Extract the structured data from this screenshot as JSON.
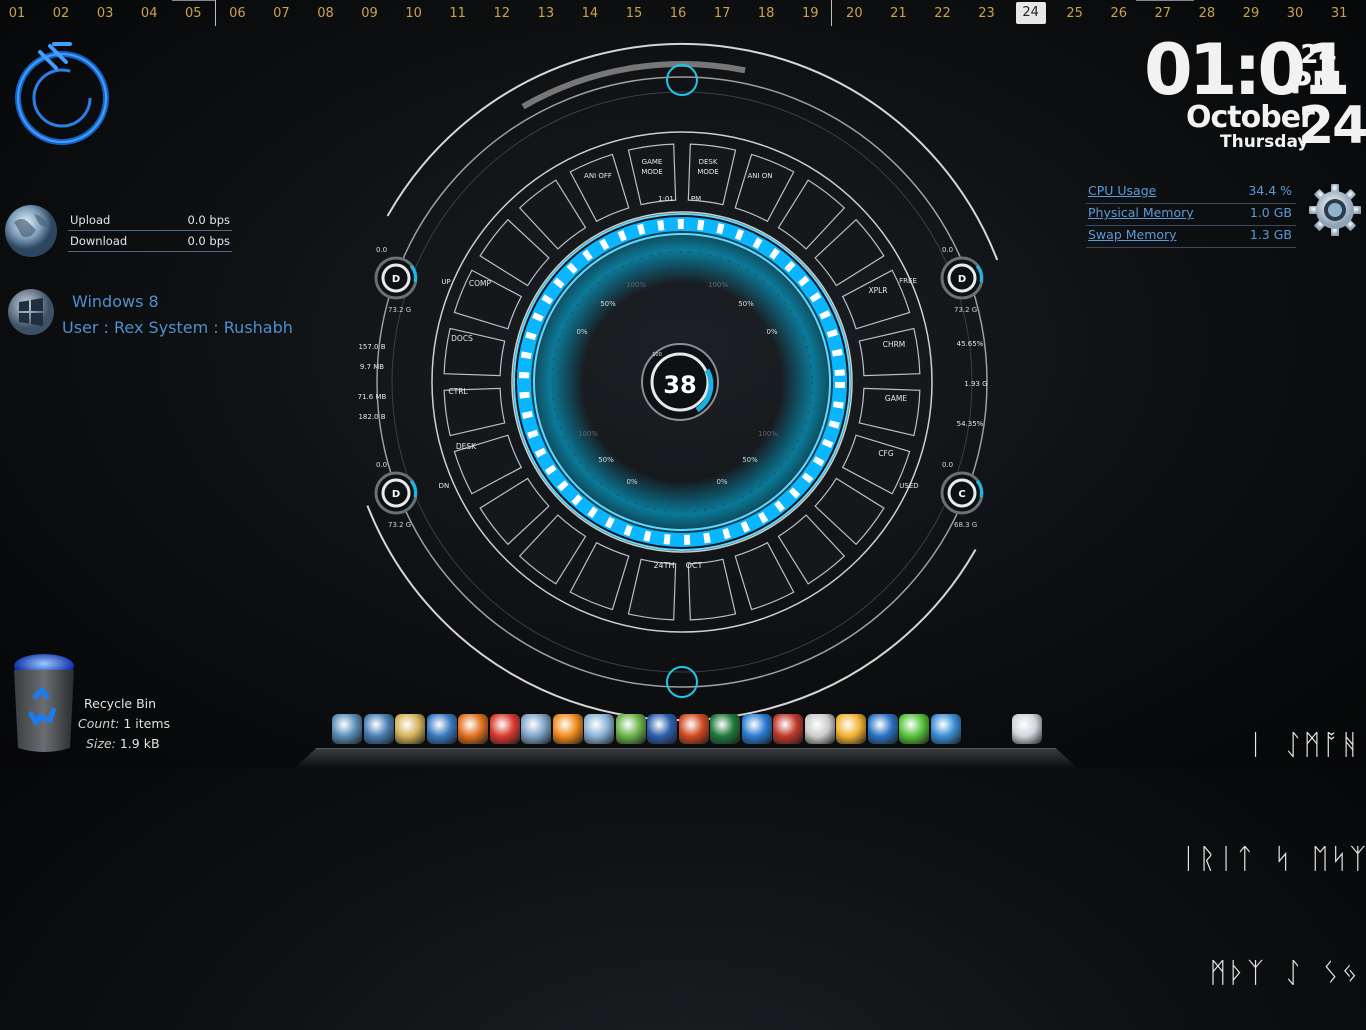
{
  "days": [
    "01",
    "02",
    "03",
    "04",
    "05",
    "06",
    "07",
    "08",
    "09",
    "10",
    "11",
    "12",
    "13",
    "14",
    "15",
    "16",
    "17",
    "18",
    "19",
    "20",
    "21",
    "22",
    "23",
    "24",
    "25",
    "26",
    "27",
    "28",
    "29",
    "30",
    "31"
  ],
  "active_day": "24",
  "clock": {
    "hours_minutes": "01:01",
    "seconds": ":24",
    "ampm": "PM",
    "month": "October",
    "weekday": "Thursday",
    "day": "24"
  },
  "system_stats": [
    {
      "label": "CPU Usage",
      "value": "34.4  %"
    },
    {
      "label": "Physical Memory",
      "value": "1.0 GB"
    },
    {
      "label": "Swap Memory",
      "value": "1.3 GB"
    }
  ],
  "network": {
    "upload_label": "Upload",
    "upload_value": "0.0 bps",
    "download_label": "Download",
    "download_value": "0.0 bps"
  },
  "os_info": {
    "os": "Windows 8",
    "user_line": "User : Rex   System : Rushabh"
  },
  "recycle_bin": {
    "title": "Recycle Bin",
    "count_label": "Count:",
    "count_value": "1 items",
    "size_label": "Size:",
    "size_value": "1.9 kB"
  },
  "hud": {
    "center_value": "38",
    "center_small": "100",
    "time": "1:01",
    "time_ampm": "PM",
    "date_day": "24TH",
    "date_month": "OCT",
    "top_buttons": [
      "ANI OFF",
      "GAME MODE",
      "DESK MODE",
      "ANI ON"
    ],
    "left_buttons": [
      "COMP",
      "DOCS",
      "CTRL",
      "DESK"
    ],
    "left_tags": [
      "UP",
      "DN"
    ],
    "right_buttons": [
      "XPLR",
      "CHRM",
      "GAME",
      "CFG"
    ],
    "right_tags": [
      "FREE",
      "USED"
    ],
    "drives": [
      {
        "letter": "D",
        "pct": "0.0",
        "size": "73.2 G"
      },
      {
        "letter": "D",
        "pct": "0.0",
        "size": "73.2 G"
      },
      {
        "letter": "D",
        "pct": "0.0",
        "size": "73.2 G"
      },
      {
        "letter": "C",
        "pct": "0.0",
        "size": "68.3 G"
      }
    ],
    "left_stats": [
      "157.0 B",
      "9.7 MB",
      "71.6 MB",
      "182.0 B"
    ],
    "right_stats": [
      "45.65%",
      "1.93 G",
      "54.35%"
    ],
    "dial_labels": [
      "100%",
      "100%",
      "50%",
      "50%",
      "0%",
      "0%",
      "100%",
      "100%",
      "50%",
      "50%",
      "0%",
      "0%"
    ]
  },
  "glyph_lines": [
    "ᛁ ᛇᛗᚩᚻ",
    "ᛁᚱᛁᛏ ᛋ ᛖᛋᛉ",
    "ᛗᚦᛉ ᛇ ᛊᛃ"
  ],
  "dock_icons": [
    {
      "name": "network-icon",
      "color": "#5a8fb8"
    },
    {
      "name": "slideshow-icon",
      "color": "#4a7fb5"
    },
    {
      "name": "media-player-icon",
      "color": "#d4b25a"
    },
    {
      "name": "globe-icon",
      "color": "#3a7ac0"
    },
    {
      "name": "firefox-icon",
      "color": "#e2701e"
    },
    {
      "name": "chrome-icon",
      "color": "#d93a2f"
    },
    {
      "name": "computer-icon",
      "color": "#7fa4c9"
    },
    {
      "name": "vlc-icon",
      "color": "#f08a1c"
    },
    {
      "name": "water-drop-icon",
      "color": "#8ab3d6"
    },
    {
      "name": "windows-media-icon",
      "color": "#6bb24a"
    },
    {
      "name": "word-icon",
      "color": "#2b5fad"
    },
    {
      "name": "powerpoint-icon",
      "color": "#d04a22"
    },
    {
      "name": "excel-icon",
      "color": "#1f7a3c"
    },
    {
      "name": "dropbox-icon",
      "color": "#2b7cd3"
    },
    {
      "name": "image-viewer-icon",
      "color": "#c0392b"
    },
    {
      "name": "clock-icon",
      "color": "#cccccc"
    },
    {
      "name": "weather-icon",
      "color": "#f2b233"
    },
    {
      "name": "calendar-icon",
      "color": "#2a73c4"
    },
    {
      "name": "battery-icon",
      "color": "#55c43a"
    },
    {
      "name": "settings-icon",
      "color": "#3a8fd6"
    },
    {
      "name": "mail-icon",
      "color": "#d0d4da"
    }
  ]
}
